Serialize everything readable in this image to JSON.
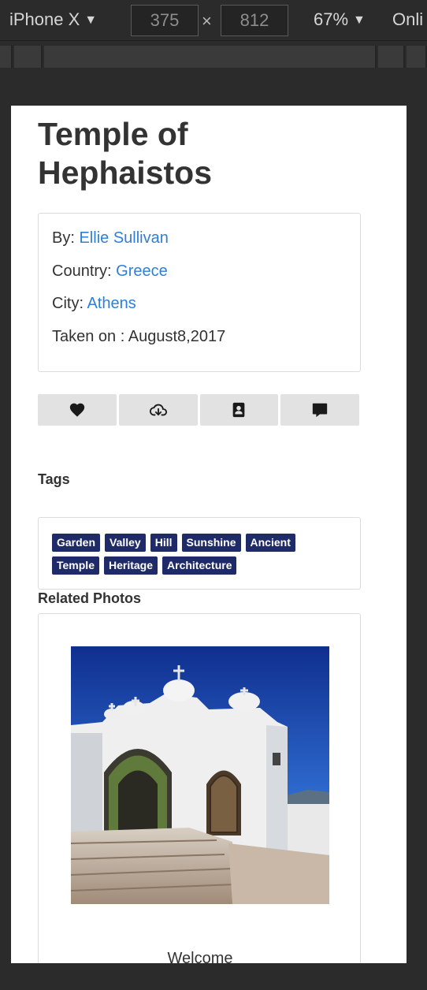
{
  "toolbar": {
    "device": "iPhone X",
    "width": "375",
    "height": "812",
    "times": "×",
    "zoom": "67%",
    "network": "Onli",
    "caret": "▼"
  },
  "page": {
    "title": "Temple of Hephaistos",
    "info": {
      "by_label": "By:",
      "author": "Ellie Sullivan",
      "country_label": "Country:",
      "country": "Greece",
      "city_label": "City:",
      "city": "Athens",
      "taken_label": "Taken on :",
      "taken_date": "August8,2017"
    },
    "actions": [
      "heart-icon",
      "cloud-download-icon",
      "contact-card-icon",
      "comment-icon"
    ],
    "tags_title": "Tags",
    "tags_row1": [
      "Garden",
      "Valley",
      "Hill",
      "Sunshine",
      "Ancient"
    ],
    "tags_row2": [
      "Temple",
      "Heritage",
      "Architecture"
    ],
    "related_title": "Related Photos",
    "related_caption": "Welcome"
  },
  "colors": {
    "link": "#2f7fd6",
    "tag_bg": "#1f2a68",
    "action_bg": "#e2e2e2"
  }
}
